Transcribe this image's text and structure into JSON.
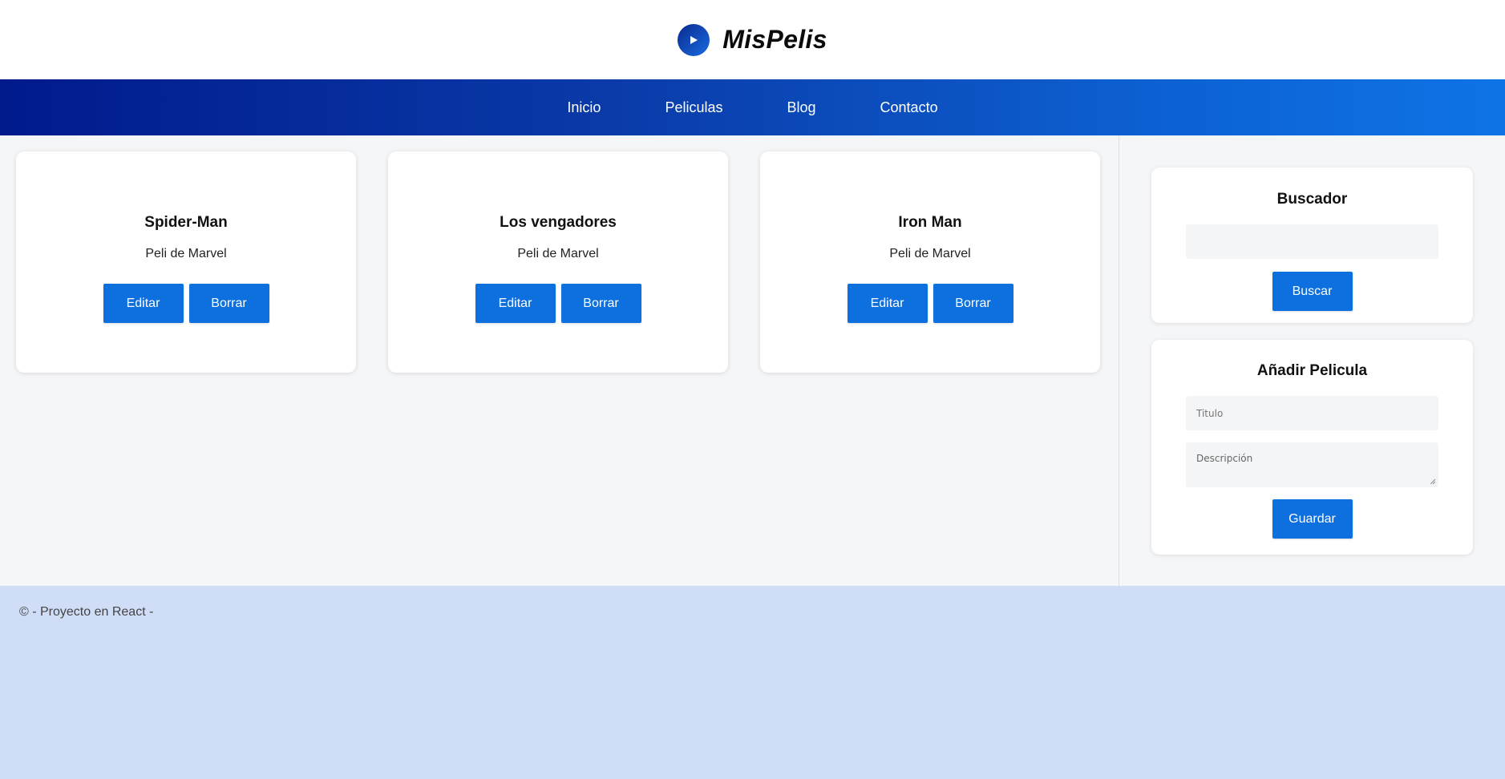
{
  "brand": {
    "name": "MisPelis",
    "icon": "play-icon"
  },
  "nav": {
    "items": [
      "Inicio",
      "Peliculas",
      "Blog",
      "Contacto"
    ]
  },
  "movies": [
    {
      "title": "Spider-Man",
      "description": "Peli de Marvel",
      "edit_label": "Editar",
      "delete_label": "Borrar"
    },
    {
      "title": "Los vengadores",
      "description": "Peli de Marvel",
      "edit_label": "Editar",
      "delete_label": "Borrar"
    },
    {
      "title": "Iron Man",
      "description": "Peli de Marvel",
      "edit_label": "Editar",
      "delete_label": "Borrar"
    }
  ],
  "search": {
    "title": "Buscador",
    "value": "",
    "button_label": "Buscar"
  },
  "add_movie": {
    "title": "Añadir Pelicula",
    "title_placeholder": "Titulo",
    "description_placeholder": "Descripción",
    "button_label": "Guardar"
  },
  "footer": {
    "text": "© - Proyecto en React -"
  },
  "colors": {
    "accent": "#0e6fde",
    "nav_start": "#001a8c",
    "nav_end": "#0e74e6",
    "footer_bg": "#d0ddf6",
    "page_bg": "#f5f6f8"
  }
}
